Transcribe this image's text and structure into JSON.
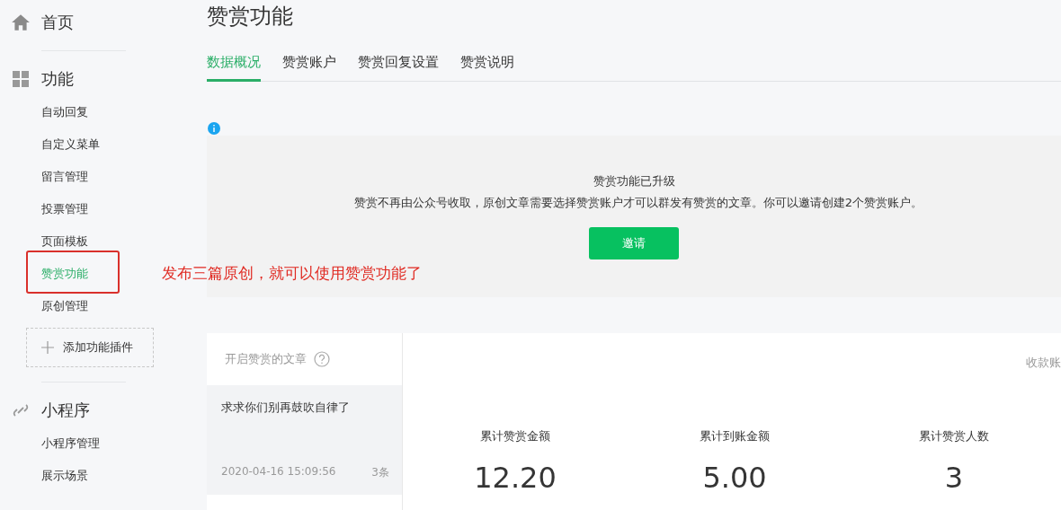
{
  "sidebar": {
    "home": {
      "label": "首页"
    },
    "sections": [
      {
        "kind": "features",
        "title": "功能",
        "items": [
          {
            "label": "自动回复",
            "selected": false
          },
          {
            "label": "自定义菜单",
            "selected": false
          },
          {
            "label": "留言管理",
            "selected": false
          },
          {
            "label": "投票管理",
            "selected": false
          },
          {
            "label": "页面模板",
            "selected": false
          },
          {
            "label": "赞赏功能",
            "selected": true
          },
          {
            "label": "原创管理",
            "selected": false
          }
        ],
        "add_button": "添加功能插件"
      },
      {
        "kind": "miniprogram",
        "title": "小程序",
        "items": [
          {
            "label": "小程序管理",
            "selected": false
          },
          {
            "label": "展示场景",
            "selected": false
          }
        ]
      }
    ]
  },
  "page": {
    "title": "赞赏功能",
    "tabs": [
      {
        "label": "数据概况",
        "selected": true
      },
      {
        "label": "赞赏账户",
        "selected": false
      },
      {
        "label": "赞赏回复设置",
        "selected": false
      },
      {
        "label": "赞赏说明",
        "selected": false
      }
    ]
  },
  "notice": {
    "title": "赞赏功能已升级",
    "text": "赞赏不再由公众号收取，原创文章需要选择赞赏账户才可以群发有赞赏的文章。你可以邀请创建2个赞赏账户。",
    "button": "邀请"
  },
  "articles": {
    "header": "开启赞赏的文章",
    "items": [
      {
        "title": "求求你们别再鼓吹自律了",
        "date": "2020-04-16 15:09:56",
        "count": "3条",
        "selected": true
      }
    ]
  },
  "stats": {
    "account_label": "收款账",
    "items": [
      {
        "label": "累计赞赏金额",
        "value": "12.20"
      },
      {
        "label": "累计到账金额",
        "value": "5.00"
      },
      {
        "label": "累计赞赏人数",
        "value": "3"
      }
    ]
  },
  "annotation": {
    "text": "发布三篇原创，就可以使用赞赏功能了"
  }
}
